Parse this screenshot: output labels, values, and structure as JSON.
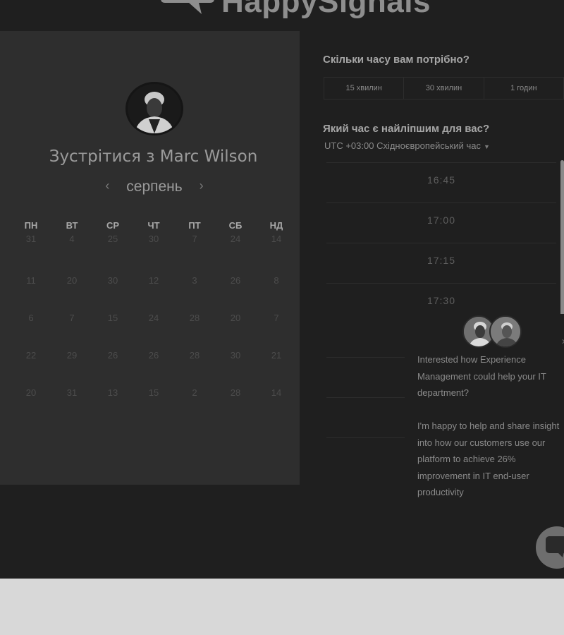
{
  "logo": {
    "text": "HappySignals",
    "icon": "speech-bubble-heart-icon"
  },
  "host": {
    "title": "Зустрітися з Marc Wilson",
    "avatar": "host-avatar"
  },
  "calendar": {
    "month": "серпень",
    "prev_icon": "chevron-left-icon",
    "next_icon": "chevron-right-icon",
    "weekdays": [
      "ПН",
      "ВТ",
      "СР",
      "ЧТ",
      "ПТ",
      "СБ",
      "НД"
    ],
    "weeks": [
      [
        "31",
        "4",
        "25",
        "30",
        "7",
        "24",
        "14"
      ],
      [
        "11",
        "20",
        "30",
        "12",
        "3",
        "26",
        "8"
      ],
      [
        "6",
        "7",
        "15",
        "24",
        "28",
        "20",
        "7"
      ],
      [
        "22",
        "29",
        "26",
        "26",
        "28",
        "30",
        "21"
      ],
      [
        "20",
        "31",
        "13",
        "15",
        "2",
        "28",
        "14"
      ]
    ]
  },
  "booking": {
    "duration_question": "Скільки часу вам потрібно?",
    "durations": [
      "15 хвилин",
      "30 хвилин",
      "1 годин"
    ],
    "time_question": "Який час є найліпшим для вас?",
    "timezone": "UTC +03:00 Східноєвропейський час",
    "slots": [
      "16:45",
      "17:00",
      "17:15",
      "17:30"
    ]
  },
  "chat": {
    "message": "Interested how Experience Management could help your IT department?\n\nI'm happy to help and share insight into how our customers use our platform to achieve 26% improvement in IT end-user productivity",
    "close_icon": "close-icon",
    "launcher_icon": "chat-bubble-icon"
  }
}
